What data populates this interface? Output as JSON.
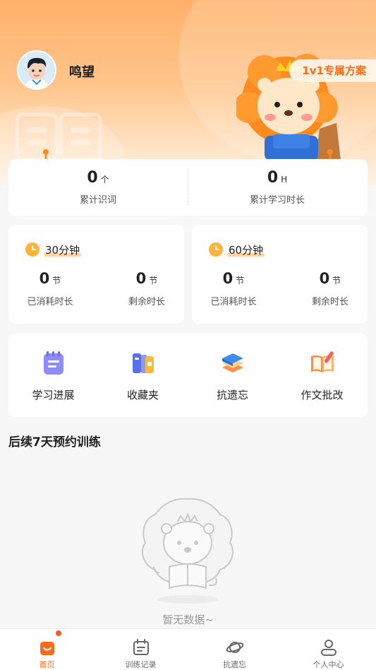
{
  "profile": {
    "name": "鸣望",
    "avatar_icon": "boy-avatar-icon"
  },
  "plan_badge": "1v1专属方案",
  "stats": [
    {
      "value": "0",
      "unit": "个",
      "label": "累计识词"
    },
    {
      "value": "0",
      "unit": "H",
      "label": "累计学习时长"
    }
  ],
  "durations": [
    {
      "title": "30分钟",
      "consumed": {
        "value": "0",
        "unit": "节",
        "label": "已消耗时长"
      },
      "remaining": {
        "value": "0",
        "unit": "节",
        "label": "剩余时长"
      }
    },
    {
      "title": "60分钟",
      "consumed": {
        "value": "0",
        "unit": "节",
        "label": "已消耗时长"
      },
      "remaining": {
        "value": "0",
        "unit": "节",
        "label": "剩余时长"
      }
    }
  ],
  "shortcuts": [
    {
      "label": "学习进展",
      "icon": "notepad-icon"
    },
    {
      "label": "收藏夹",
      "icon": "folders-icon"
    },
    {
      "label": "抗遗忘",
      "icon": "stacked-books-icon"
    },
    {
      "label": "作文批改",
      "icon": "open-book-pencil-icon"
    }
  ],
  "section": {
    "title": "后续7天预约训练"
  },
  "empty": {
    "text": "暂无数据~"
  },
  "tabs": [
    {
      "label": "首页",
      "icon": "home-icon",
      "active": true
    },
    {
      "label": "训练记录",
      "icon": "calendar-icon",
      "active": false
    },
    {
      "label": "抗遗忘",
      "icon": "planet-icon",
      "active": false
    },
    {
      "label": "个人中心",
      "icon": "user-icon",
      "active": false
    }
  ],
  "colors": {
    "accent": "#ff6a16",
    "hero_top": "#ffb16a",
    "badge_text": "#ff6a16"
  }
}
